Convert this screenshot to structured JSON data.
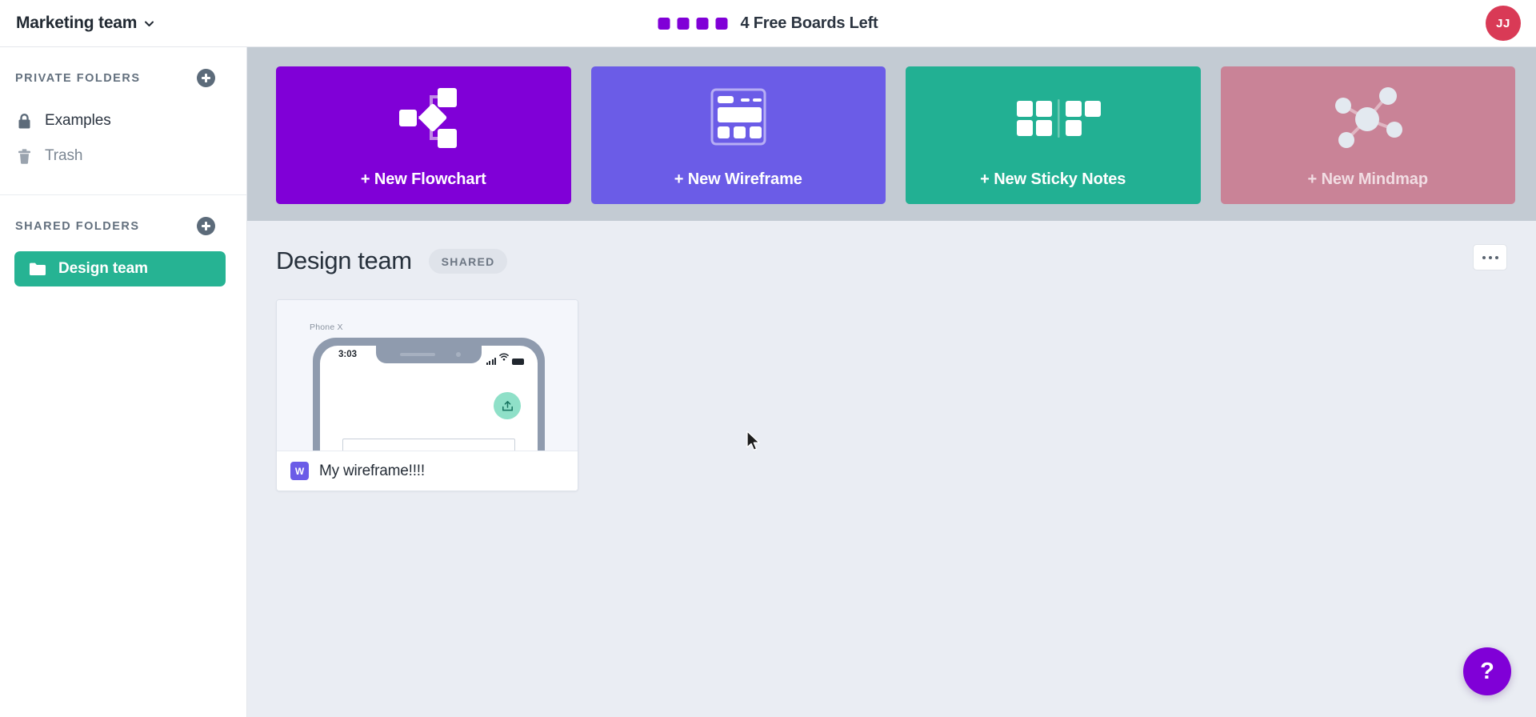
{
  "topbar": {
    "team_name": "Marketing team",
    "chevron_icon": "chevron-down-icon",
    "boards_left_text": "4 Free Boards Left",
    "pip_count": 4,
    "pip_color": "#8000d7",
    "avatar_initials": "JJ",
    "avatar_color": "#d93a56"
  },
  "sidebar": {
    "private": {
      "title": "PRIVATE FOLDERS",
      "add_icon": "plus-icon",
      "items": [
        {
          "label": "Examples",
          "icon": "lock-icon",
          "selected": false
        },
        {
          "label": "Trash",
          "icon": "trash-icon",
          "selected": false
        }
      ]
    },
    "shared": {
      "title": "SHARED FOLDERS",
      "add_icon": "plus-icon",
      "items": [
        {
          "label": "Design team",
          "icon": "folder-icon",
          "selected": true
        }
      ]
    }
  },
  "create_cards": [
    {
      "label": "+ New Flowchart",
      "icon": "flowchart-icon",
      "color": "#8000d7"
    },
    {
      "label": "+ New Wireframe",
      "icon": "wireframe-icon",
      "color": "#6b5ce7"
    },
    {
      "label": "+ New Sticky Notes",
      "icon": "sticky-notes-icon",
      "color": "#22b093"
    },
    {
      "label": "+ New Mindmap",
      "icon": "mindmap-icon",
      "color": "#c98397"
    }
  ],
  "folder": {
    "title": "Design team",
    "badge": "SHARED",
    "menu_icon": "ellipsis-icon"
  },
  "boards": [
    {
      "name": "My wireframe!!!!",
      "badge": "W",
      "badge_color": "#6b5ce7",
      "thumbnail": {
        "caption": "Phone X",
        "status_time": "3:03",
        "signal_icon": "signal-bars-icon",
        "wifi_icon": "wifi-icon",
        "battery_icon": "battery-icon",
        "fab_icon": "upload-icon"
      }
    }
  ],
  "help": {
    "label": "?"
  }
}
